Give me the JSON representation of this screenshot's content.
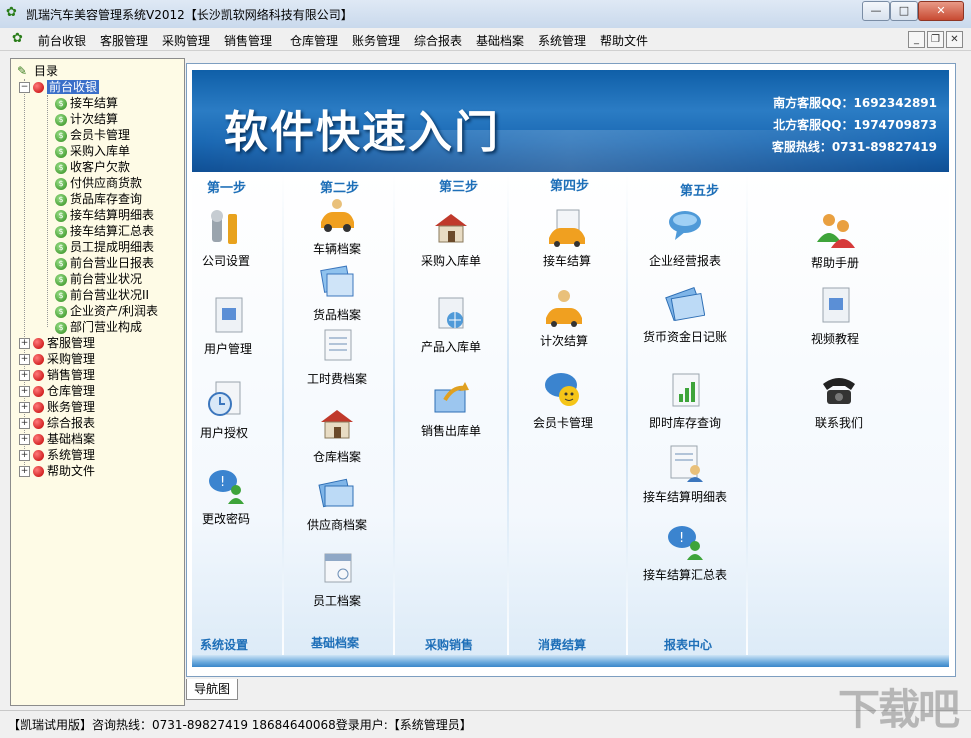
{
  "window": {
    "title": "凯瑞汽车美容管理系统V2012【长沙凯软网络科技有限公司】",
    "minimize": "—",
    "maximize": "□",
    "close": "✕"
  },
  "menu": [
    "前台收银",
    "客服管理",
    "采购管理",
    "销售管理",
    "仓库管理",
    "账务管理",
    "综合报表",
    "基础档案",
    "系统管理",
    "帮助文件"
  ],
  "tree": {
    "root": "目录",
    "groups": [
      {
        "label": "前台收银",
        "expanded": true,
        "selected": true,
        "children": [
          "接车结算",
          "计次结算",
          "会员卡管理",
          "采购入库单",
          "收客户欠款",
          "付供应商货款",
          "货品库存查询",
          "接车结算明细表",
          "接车结算汇总表",
          "员工提成明细表",
          "前台营业日报表",
          "前台营业状况",
          "前台营业状况II",
          "企业资产/利润表",
          "部门营业构成"
        ]
      },
      {
        "label": "客服管理"
      },
      {
        "label": "采购管理"
      },
      {
        "label": "销售管理"
      },
      {
        "label": "仓库管理"
      },
      {
        "label": "账务管理"
      },
      {
        "label": "综合报表"
      },
      {
        "label": "基础档案"
      },
      {
        "label": "系统管理"
      },
      {
        "label": "帮助文件"
      }
    ]
  },
  "banner": {
    "title": "软件快速入门",
    "contacts": [
      "南方客服QQ：1692342891",
      "北方客服QQ：1974709873",
      "客服热线：0731-89827419"
    ]
  },
  "columns": [
    {
      "step": "第一步",
      "footer": "系统设置",
      "items": [
        "公司设置",
        "用户管理",
        "用户授权",
        "更改密码"
      ]
    },
    {
      "step": "第二步",
      "footer": "基础档案",
      "items": [
        "车辆档案",
        "货品档案",
        "工时费档案",
        "仓库档案",
        "供应商档案",
        "员工档案"
      ]
    },
    {
      "step": "第三步",
      "footer": "采购销售",
      "items": [
        "采购入库单",
        "产品入库单",
        "销售出库单"
      ]
    },
    {
      "step": "第四步",
      "footer": "消费结算",
      "items": [
        "接车结算",
        "计次结算",
        "会员卡管理"
      ]
    },
    {
      "step": "第五步",
      "footer": "报表中心",
      "items": [
        "企业经营报表",
        "货币资金日记账",
        "即时库存查询",
        "接车结算明细表",
        "接车结算汇总表"
      ]
    },
    {
      "step": "",
      "footer": "",
      "items": [
        "帮助手册",
        "视频教程",
        "联系我们"
      ]
    }
  ],
  "tabs": [
    "导航图"
  ],
  "status": "【凯瑞试用版】咨询热线：0731-89827419 18684640068登录用户:【系统管理员】",
  "watermark": "下载吧"
}
